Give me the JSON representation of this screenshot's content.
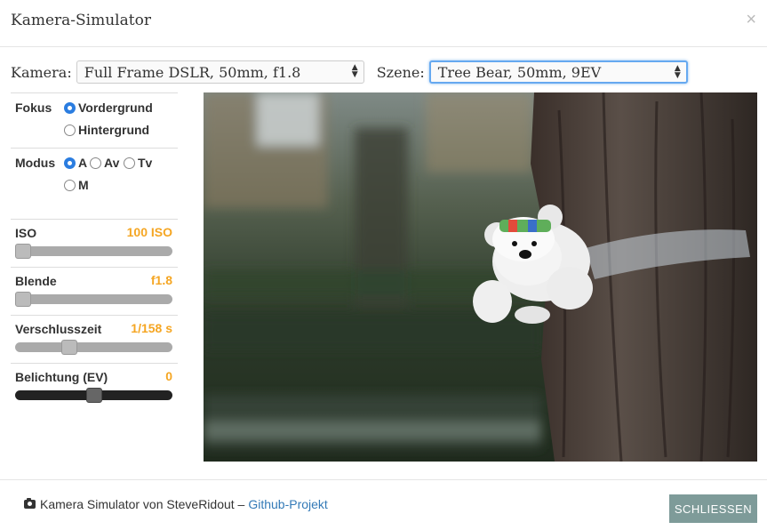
{
  "dialog": {
    "title": "Kamera-Simulator",
    "close_glyph": "×"
  },
  "camera": {
    "label": "Kamera:",
    "selected": "Full Frame DSLR, 50mm, f1.8"
  },
  "scene": {
    "label": "Szene:",
    "selected": "Tree Bear, 50mm, 9EV"
  },
  "focus": {
    "label": "Fokus",
    "options": [
      "Vordergrund",
      "Hintergrund"
    ],
    "selected": "Vordergrund"
  },
  "mode": {
    "label": "Modus",
    "options": [
      "A",
      "Av",
      "Tv",
      "M"
    ],
    "selected": "A"
  },
  "sliders": {
    "iso": {
      "label": "ISO",
      "value": "100 ISO",
      "level": 0.0
    },
    "aperture": {
      "label": "Blende",
      "value": "f1.8",
      "level": 0.0
    },
    "shutter": {
      "label": "Verschlusszeit",
      "value": "1/158 s",
      "level": 0.33
    },
    "exposure": {
      "label": "Belichtung (EV)",
      "value": "0",
      "level": 0.5
    }
  },
  "footer": {
    "credit_text": "Kamera Simulator von SteveRidout –",
    "link_text": "Github-Projekt",
    "close_button": "SCHLIESSEN"
  },
  "colors": {
    "accent": "#f5a623",
    "link": "#337ab7",
    "button": "#7e9b99",
    "radio": "#2b7de0"
  }
}
